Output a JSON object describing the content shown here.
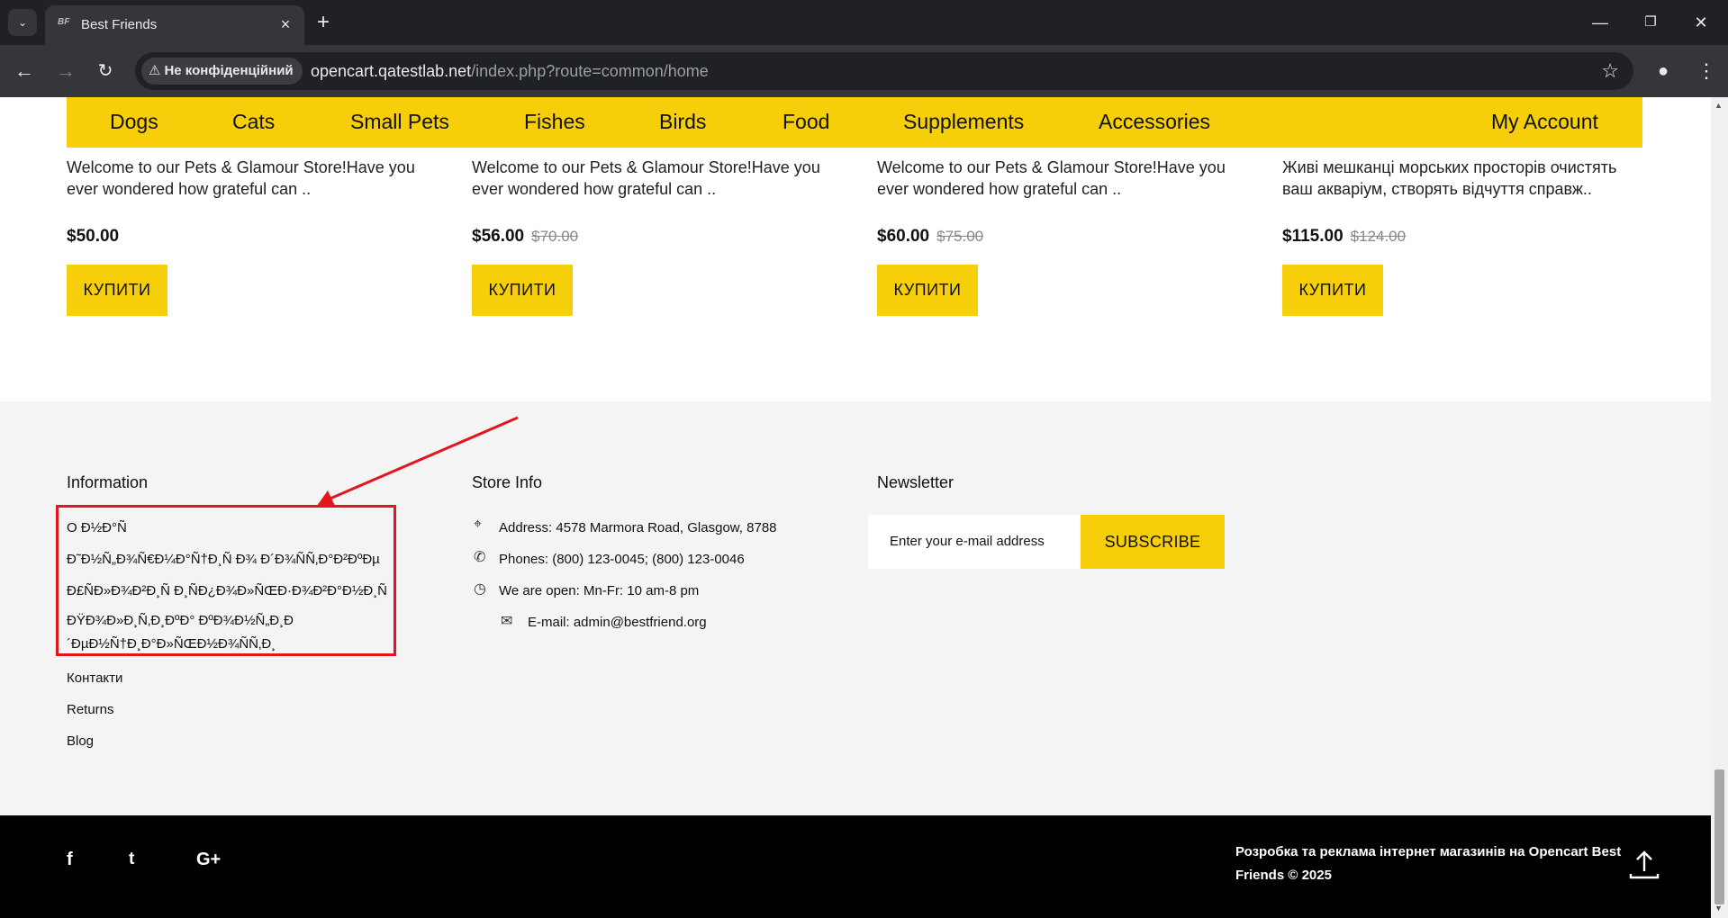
{
  "browser": {
    "tab_title": "Best Friends",
    "tab_favicon": "BF",
    "security_label": "Не конфіденційний",
    "url_host": "opencart.qatestlab.net",
    "url_path": "/index.php?route=common/home"
  },
  "nav": {
    "items": [
      "Dogs",
      "Cats",
      "Small Pets",
      "Fishes",
      "Birds",
      "Food",
      "Supplements",
      "Accessories"
    ],
    "account": "My Account"
  },
  "products": [
    {
      "desc": "Welcome to our Pets & Glamour Store!Have you ever wondered how grateful can ..",
      "price": "$50.00",
      "old_price": "",
      "buy": "КУПИТИ"
    },
    {
      "desc": "Welcome to our Pets & Glamour Store!Have you ever wondered how grateful can ..",
      "price": "$56.00",
      "old_price": "$70.00",
      "buy": "КУПИТИ"
    },
    {
      "desc": "Welcome to our Pets & Glamour Store!Have you ever wondered how grateful can ..",
      "price": "$60.00",
      "old_price": "$75.00",
      "buy": "КУПИТИ"
    },
    {
      "desc": "Живі мешканці морських просторів очистять ваш акваріум, створять відчуття справж..",
      "price": "$115.00",
      "old_price": "$124.00",
      "buy": "КУПИТИ"
    }
  ],
  "footer": {
    "information": {
      "title": "Information",
      "links": [
        "О Ð½Ð°Ñ",
        "Ð˜Ð½Ñ„Ð¾Ñ€Ð¼Ð°Ñ†Ð¸Ñ Ð¾ Ð´Ð¾ÑÑ‚Ð°Ð²ÐºÐµ",
        "Ð£ÑÐ»Ð¾Ð²Ð¸Ñ Ð¸ÑÐ¿Ð¾Ð»ÑŒÐ·Ð¾Ð²Ð°Ð½Ð¸Ñ",
        "ÐŸÐ¾Ð»Ð¸Ñ‚Ð¸ÐºÐ° ÐºÐ¾Ð½Ñ„Ð¸Ð´ÐµÐ½Ñ†Ð¸Ð°Ð»ÑŒÐ½Ð¾ÑÑ‚Ð¸",
        "Контакти",
        "Returns",
        "Blog"
      ]
    },
    "store_info": {
      "title": "Store Info",
      "address": "Address: 4578 Marmora Road, Glasgow, 8788",
      "phones": "Phones: (800) 123-0045; (800) 123-0046",
      "hours": "We are open: Mn-Fr: 10 am-8 pm",
      "email": "E-mail: admin@bestfriend.org"
    },
    "newsletter": {
      "title": "Newsletter",
      "placeholder": "Enter your e-mail address",
      "button": "SUBSCRIBE"
    }
  },
  "bottom": {
    "social": [
      "f",
      "t",
      "G+"
    ],
    "copyright": "Розробка та реклама інтернет магазинів на Opencart Best Friends © 2025"
  }
}
